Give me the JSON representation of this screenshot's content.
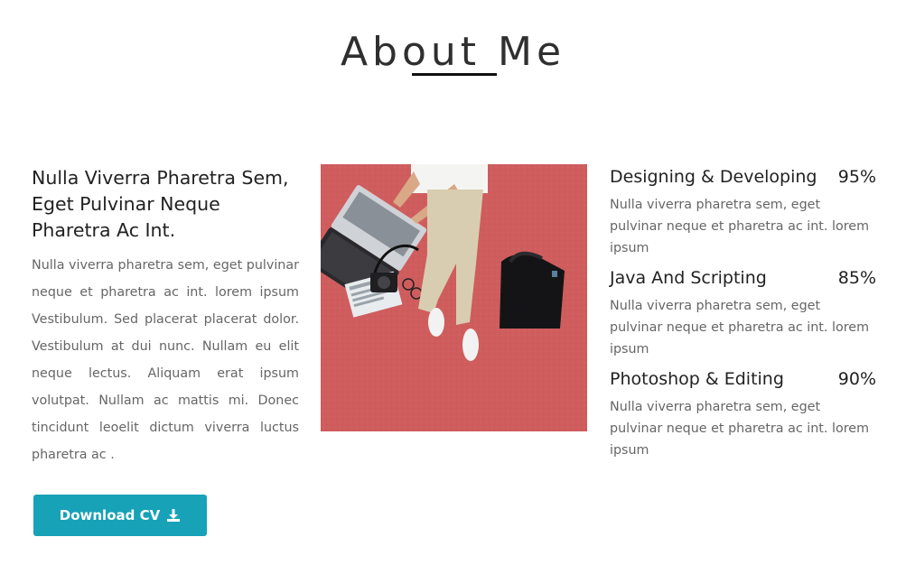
{
  "section": {
    "title": "About Me"
  },
  "intro": {
    "heading": "Nulla Viverra Pharetra Sem, Eget Pulvinar Neque Pharetra Ac Int.",
    "paragraph": "Nulla viverra pharetra sem, eget pulvinar neque et pharetra ac int. lorem ipsum Vestibulum. Sed placerat placerat dolor. Vestibulum at dui nunc. Nullam eu elit neque lectus. Aliquam erat ipsum volutpat. Nullam ac mattis mi. Donec tincidunt leoelit dictum viverra luctus pharetra ac ."
  },
  "download_button": {
    "label": "Download CV",
    "icon": "download-icon",
    "color": "#17a2b8"
  },
  "skills": [
    {
      "name": "Designing & Developing",
      "percent": "95%",
      "description": "Nulla viverra pharetra sem, eget pulvinar neque et pharetra ac int. lorem ipsum"
    },
    {
      "name": "Java And Scripting",
      "percent": "85%",
      "description": "Nulla viverra pharetra sem, eget pulvinar neque et pharetra ac int. lorem ipsum"
    },
    {
      "name": "Photoshop & Editing",
      "percent": "90%",
      "description": "Nulla viverra pharetra sem, eget pulvinar neque et pharetra ac int. lorem ipsum"
    }
  ]
}
